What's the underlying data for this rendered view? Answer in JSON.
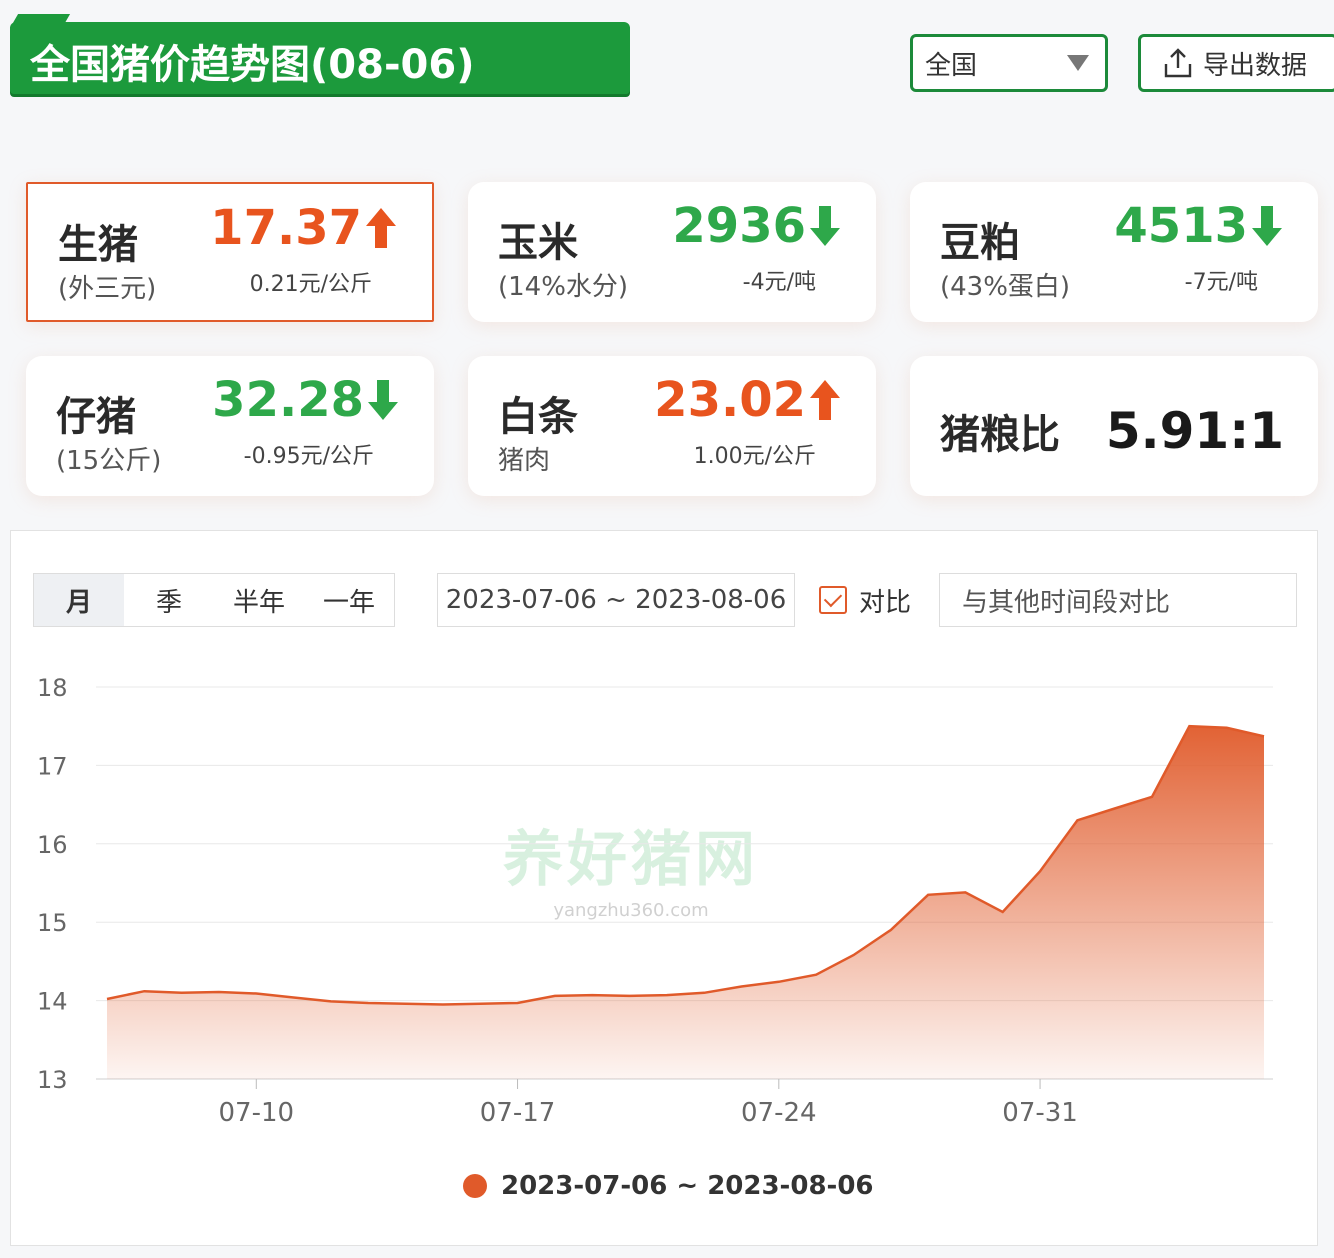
{
  "header": {
    "title": "全国猪价趋势图(08-06)",
    "region_selected": "全国",
    "export_label": "导出数据"
  },
  "cards": [
    {
      "name": "生猪",
      "sub": "(外三元)",
      "price": "17.37",
      "direction": "up",
      "change": "0.21元/公斤"
    },
    {
      "name": "玉米",
      "sub": "(14%水分)",
      "price": "2936",
      "direction": "down",
      "change": "-4元/吨"
    },
    {
      "name": "豆粕",
      "sub": "(43%蛋白)",
      "price": "4513",
      "direction": "down",
      "change": "-7元/吨"
    },
    {
      "name": "仔猪",
      "sub": "(15公斤)",
      "price": "32.28",
      "direction": "down",
      "change": "-0.95元/公斤"
    },
    {
      "name": "白条",
      "sub": "猪肉",
      "price": "23.02",
      "direction": "up",
      "change": "1.00元/公斤"
    }
  ],
  "ratio_card": {
    "name": "猪粮比",
    "value": "5.91:1"
  },
  "controls": {
    "tabs": [
      "月",
      "季",
      "半年",
      "一年"
    ],
    "date_range": "2023-07-06 ~ 2023-08-06",
    "compare_label": "对比",
    "compare_placeholder": "与其他时间段对比"
  },
  "watermark": {
    "line1": "养好猪网",
    "line2": "yangzhu360.com"
  },
  "colors": {
    "up": "#e8541e",
    "down": "#2ea84a",
    "series": "#e05a2a",
    "brand": "#1c9a3c"
  },
  "chart_data": {
    "type": "area",
    "x": [
      "2023-07-06",
      "2023-07-07",
      "2023-07-08",
      "2023-07-09",
      "2023-07-10",
      "2023-07-11",
      "2023-07-12",
      "2023-07-13",
      "2023-07-14",
      "2023-07-15",
      "2023-07-16",
      "2023-07-17",
      "2023-07-18",
      "2023-07-19",
      "2023-07-20",
      "2023-07-21",
      "2023-07-22",
      "2023-07-23",
      "2023-07-24",
      "2023-07-25",
      "2023-07-26",
      "2023-07-27",
      "2023-07-28",
      "2023-07-29",
      "2023-07-30",
      "2023-07-31",
      "2023-08-01",
      "2023-08-02",
      "2023-08-03",
      "2023-08-04",
      "2023-08-05",
      "2023-08-06"
    ],
    "x_ticks": [
      "07-10",
      "07-17",
      "07-24",
      "07-31"
    ],
    "series": [
      {
        "name": "2023-07-06 ~ 2023-08-06",
        "values": [
          14.02,
          14.12,
          14.1,
          14.11,
          14.09,
          14.04,
          13.99,
          13.97,
          13.96,
          13.95,
          13.96,
          13.97,
          14.06,
          14.07,
          14.06,
          14.07,
          14.1,
          14.18,
          14.24,
          14.33,
          14.58,
          14.9,
          15.35,
          15.38,
          15.13,
          15.65,
          16.3,
          16.45,
          16.6,
          17.5,
          17.48,
          17.37
        ]
      }
    ],
    "legend": [
      "2023-07-06 ~ 2023-08-06"
    ],
    "y_ticks": [
      13,
      14,
      15,
      16,
      17,
      18
    ],
    "ylim": [
      13,
      18
    ],
    "grid": true,
    "legend_position": "bottom"
  }
}
